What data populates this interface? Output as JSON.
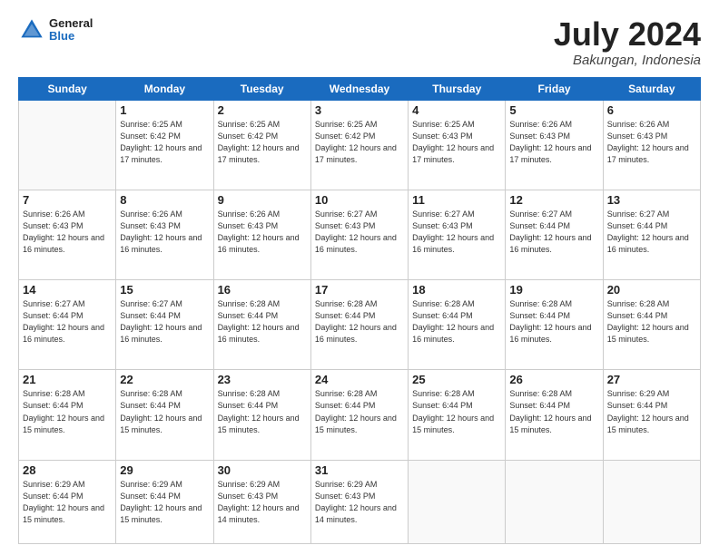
{
  "header": {
    "logo_general": "General",
    "logo_blue": "Blue",
    "title": "July 2024",
    "location": "Bakungan, Indonesia"
  },
  "days_of_week": [
    "Sunday",
    "Monday",
    "Tuesday",
    "Wednesday",
    "Thursday",
    "Friday",
    "Saturday"
  ],
  "weeks": [
    [
      {
        "day": "",
        "sunrise": "",
        "sunset": "",
        "daylight": ""
      },
      {
        "day": "1",
        "sunrise": "Sunrise: 6:25 AM",
        "sunset": "Sunset: 6:42 PM",
        "daylight": "Daylight: 12 hours and 17 minutes."
      },
      {
        "day": "2",
        "sunrise": "Sunrise: 6:25 AM",
        "sunset": "Sunset: 6:42 PM",
        "daylight": "Daylight: 12 hours and 17 minutes."
      },
      {
        "day": "3",
        "sunrise": "Sunrise: 6:25 AM",
        "sunset": "Sunset: 6:42 PM",
        "daylight": "Daylight: 12 hours and 17 minutes."
      },
      {
        "day": "4",
        "sunrise": "Sunrise: 6:25 AM",
        "sunset": "Sunset: 6:43 PM",
        "daylight": "Daylight: 12 hours and 17 minutes."
      },
      {
        "day": "5",
        "sunrise": "Sunrise: 6:26 AM",
        "sunset": "Sunset: 6:43 PM",
        "daylight": "Daylight: 12 hours and 17 minutes."
      },
      {
        "day": "6",
        "sunrise": "Sunrise: 6:26 AM",
        "sunset": "Sunset: 6:43 PM",
        "daylight": "Daylight: 12 hours and 17 minutes."
      }
    ],
    [
      {
        "day": "7",
        "sunrise": "Sunrise: 6:26 AM",
        "sunset": "Sunset: 6:43 PM",
        "daylight": "Daylight: 12 hours and 16 minutes."
      },
      {
        "day": "8",
        "sunrise": "Sunrise: 6:26 AM",
        "sunset": "Sunset: 6:43 PM",
        "daylight": "Daylight: 12 hours and 16 minutes."
      },
      {
        "day": "9",
        "sunrise": "Sunrise: 6:26 AM",
        "sunset": "Sunset: 6:43 PM",
        "daylight": "Daylight: 12 hours and 16 minutes."
      },
      {
        "day": "10",
        "sunrise": "Sunrise: 6:27 AM",
        "sunset": "Sunset: 6:43 PM",
        "daylight": "Daylight: 12 hours and 16 minutes."
      },
      {
        "day": "11",
        "sunrise": "Sunrise: 6:27 AM",
        "sunset": "Sunset: 6:43 PM",
        "daylight": "Daylight: 12 hours and 16 minutes."
      },
      {
        "day": "12",
        "sunrise": "Sunrise: 6:27 AM",
        "sunset": "Sunset: 6:44 PM",
        "daylight": "Daylight: 12 hours and 16 minutes."
      },
      {
        "day": "13",
        "sunrise": "Sunrise: 6:27 AM",
        "sunset": "Sunset: 6:44 PM",
        "daylight": "Daylight: 12 hours and 16 minutes."
      }
    ],
    [
      {
        "day": "14",
        "sunrise": "Sunrise: 6:27 AM",
        "sunset": "Sunset: 6:44 PM",
        "daylight": "Daylight: 12 hours and 16 minutes."
      },
      {
        "day": "15",
        "sunrise": "Sunrise: 6:27 AM",
        "sunset": "Sunset: 6:44 PM",
        "daylight": "Daylight: 12 hours and 16 minutes."
      },
      {
        "day": "16",
        "sunrise": "Sunrise: 6:28 AM",
        "sunset": "Sunset: 6:44 PM",
        "daylight": "Daylight: 12 hours and 16 minutes."
      },
      {
        "day": "17",
        "sunrise": "Sunrise: 6:28 AM",
        "sunset": "Sunset: 6:44 PM",
        "daylight": "Daylight: 12 hours and 16 minutes."
      },
      {
        "day": "18",
        "sunrise": "Sunrise: 6:28 AM",
        "sunset": "Sunset: 6:44 PM",
        "daylight": "Daylight: 12 hours and 16 minutes."
      },
      {
        "day": "19",
        "sunrise": "Sunrise: 6:28 AM",
        "sunset": "Sunset: 6:44 PM",
        "daylight": "Daylight: 12 hours and 16 minutes."
      },
      {
        "day": "20",
        "sunrise": "Sunrise: 6:28 AM",
        "sunset": "Sunset: 6:44 PM",
        "daylight": "Daylight: 12 hours and 15 minutes."
      }
    ],
    [
      {
        "day": "21",
        "sunrise": "Sunrise: 6:28 AM",
        "sunset": "Sunset: 6:44 PM",
        "daylight": "Daylight: 12 hours and 15 minutes."
      },
      {
        "day": "22",
        "sunrise": "Sunrise: 6:28 AM",
        "sunset": "Sunset: 6:44 PM",
        "daylight": "Daylight: 12 hours and 15 minutes."
      },
      {
        "day": "23",
        "sunrise": "Sunrise: 6:28 AM",
        "sunset": "Sunset: 6:44 PM",
        "daylight": "Daylight: 12 hours and 15 minutes."
      },
      {
        "day": "24",
        "sunrise": "Sunrise: 6:28 AM",
        "sunset": "Sunset: 6:44 PM",
        "daylight": "Daylight: 12 hours and 15 minutes."
      },
      {
        "day": "25",
        "sunrise": "Sunrise: 6:28 AM",
        "sunset": "Sunset: 6:44 PM",
        "daylight": "Daylight: 12 hours and 15 minutes."
      },
      {
        "day": "26",
        "sunrise": "Sunrise: 6:28 AM",
        "sunset": "Sunset: 6:44 PM",
        "daylight": "Daylight: 12 hours and 15 minutes."
      },
      {
        "day": "27",
        "sunrise": "Sunrise: 6:29 AM",
        "sunset": "Sunset: 6:44 PM",
        "daylight": "Daylight: 12 hours and 15 minutes."
      }
    ],
    [
      {
        "day": "28",
        "sunrise": "Sunrise: 6:29 AM",
        "sunset": "Sunset: 6:44 PM",
        "daylight": "Daylight: 12 hours and 15 minutes."
      },
      {
        "day": "29",
        "sunrise": "Sunrise: 6:29 AM",
        "sunset": "Sunset: 6:44 PM",
        "daylight": "Daylight: 12 hours and 15 minutes."
      },
      {
        "day": "30",
        "sunrise": "Sunrise: 6:29 AM",
        "sunset": "Sunset: 6:43 PM",
        "daylight": "Daylight: 12 hours and 14 minutes."
      },
      {
        "day": "31",
        "sunrise": "Sunrise: 6:29 AM",
        "sunset": "Sunset: 6:43 PM",
        "daylight": "Daylight: 12 hours and 14 minutes."
      },
      {
        "day": "",
        "sunrise": "",
        "sunset": "",
        "daylight": ""
      },
      {
        "day": "",
        "sunrise": "",
        "sunset": "",
        "daylight": ""
      },
      {
        "day": "",
        "sunrise": "",
        "sunset": "",
        "daylight": ""
      }
    ]
  ]
}
